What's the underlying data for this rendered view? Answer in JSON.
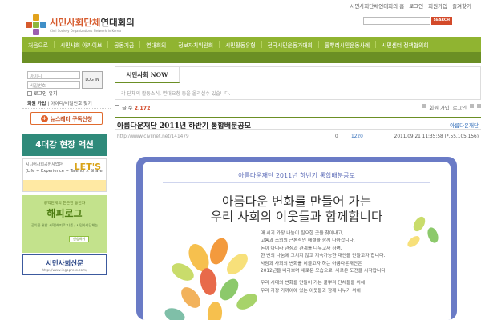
{
  "util_links": [
    "시민사회단체연대회의 홈",
    "로그인",
    "회원가입",
    "즐겨찾기"
  ],
  "logo": {
    "name_hl": "시민사회단체",
    "name_rest": "연대회의",
    "subtitle": "Civil Society Organizations Network in Korea"
  },
  "search": {
    "value": "",
    "button": "SEARCH"
  },
  "nav": [
    "처음으로",
    "시민사회 아카이브",
    "공동기금",
    "연대회의",
    "정보자치위원회",
    "시민활동유형",
    "전국시민운동가대회",
    "풀뿌리시민운동사례",
    "시민센터 정책협의회"
  ],
  "login": {
    "id_placeholder": "아이디",
    "pw_placeholder": "비밀번호",
    "button": "LOG IN",
    "keep": "로그인 유지",
    "links_label": "회원 가입",
    "links_rest": "| 아이디/비밀번호 찾기"
  },
  "newsletter": {
    "icon": "+",
    "label": "뉴스레터 구독신청"
  },
  "banners": {
    "b1": "4대강 현장 액션",
    "b2_top": "시니어사회공헌사업단",
    "b2_line": "(Life + Experience + Talent) × Share",
    "b2_lets": "LET'S",
    "b3_top": "공익단체의 든든한 동반자",
    "b3_main": "해피로그",
    "b3_sub": "공익을 위한 시작(해피로그)를 / 시민사회단체는",
    "b3_btn": "신청하기",
    "b4_main": "시민사회신문",
    "b4_url": "http://www.ingopress.com/"
  },
  "now": {
    "tab": "시민사회 NOW",
    "desc": "각 단체의 활동소식, 연대요청 등을 올리실수 있습니다."
  },
  "meta": {
    "count_label": "글 수",
    "count": "2,172",
    "signup": "회원 가입",
    "login": "로그인"
  },
  "post": {
    "title": "아름다운재단 2011년 하반기 통합배분공모",
    "author": "아름다운재단",
    "url": "http://www.civilnet.net/141479",
    "comments": "0",
    "views": "1220",
    "date": "2011.09.21 11:35:58 (*.55.105.156)"
  },
  "poster": {
    "title": "아름다운재단 2011년 하반기 통합배분공모",
    "headline1": "아름다운 변화를 만들어 가는",
    "headline2": "우리 사회의 이웃들과 함께합니다",
    "lines1": [
      "매 시기 가장 나눔이 필요한 곳을 찾아내고,",
      "고통과 소외의 근본적인 해결을 함께 나아갑니다.",
      "돈이 아니라 관심과 관계를 나누고자 하며,",
      "한 번의 나눔에 그치지 않고 지속가능한 대안을 만들고자 합니다.",
      "사람과 사회의 변화를 이끌고자 하는 아름다운재단은",
      "2012년을 바라보며 새로운 모습으로, 새로운 도전을 시작합니다."
    ],
    "lines2": [
      "우리 시대의 변화를 만들어 가는 풀뿌리 단체들을 위해",
      "우리 가장 가까이에 있는 이웃들과 함께 나누기 위해"
    ]
  }
}
